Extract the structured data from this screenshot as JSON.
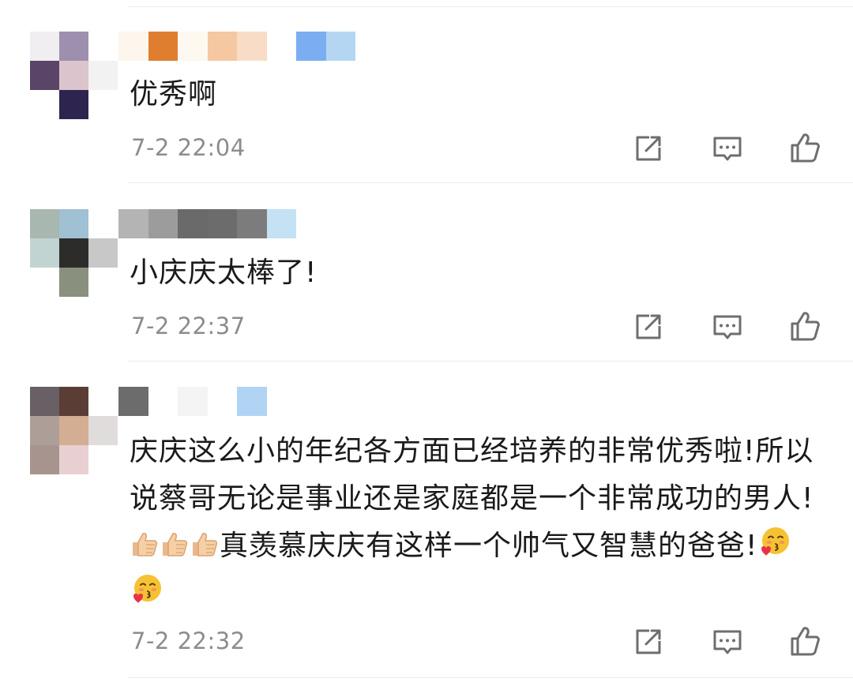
{
  "comments": [
    {
      "text": "优秀啊",
      "time": "7-2 22:04",
      "avatar_colors": [
        "#f0eef0",
        "#9e8fae",
        "#ffffff",
        "#5a4468",
        "#dcc4cc",
        "#f2f2f2",
        "#ffffff",
        "#2e2450",
        "#ffffff"
      ],
      "name_colors": [
        "#fdf6ec",
        "#e07e30",
        "#fdf8f0",
        "#f5c8a2",
        "#f8dcc6",
        "#ffffff",
        "#7aaef0",
        "#b4d6f2"
      ]
    },
    {
      "text": "小庆庆太棒了!",
      "time": "7-2 22:37",
      "avatar_colors": [
        "#a8b8b0",
        "#a0c0d4",
        "#ffffff",
        "#c2d4d2",
        "#2c2c2a",
        "#c8c8c8",
        "#ffffff",
        "#8a907e",
        "#ffffff"
      ],
      "name_colors": [
        "#b4b4b4",
        "#9c9c9c",
        "#6a6a6a",
        "#6c6c6c",
        "#7c7c7c",
        "#c4e2f4"
      ]
    },
    {
      "text_parts": {
        "before": "庆庆这么小的年纪各方面已经培养的非常优秀啦!所以说蔡哥无论是事业还是家庭都是一个非常成功的男人!",
        "middle": "真羡慕庆庆有这样一个帅气又智慧的爸爸!",
        "after": ""
      },
      "time": "7-2 22:32",
      "avatar_colors": [
        "#686064",
        "#5a3e36",
        "#ffffff",
        "#ae9e98",
        "#d4ae92",
        "#e0dcdc",
        "#a8948e",
        "#e8d0d2",
        "#ffffff"
      ],
      "name_colors": [
        "#6c6c6c",
        "#ffffff",
        "#f4f4f4",
        "#ffffff",
        "#b2d4f4"
      ]
    }
  ],
  "icons": {
    "share": "share-icon",
    "reply": "comment-icon",
    "like": "thumbs-up-icon",
    "emoji_thumb": "thumbs-up-emoji",
    "emoji_kiss": "blowing-kiss-emoji"
  },
  "colors": {
    "text": "#1a1a1a",
    "time": "#8c8c8c",
    "icon": "#6e6e6e"
  }
}
